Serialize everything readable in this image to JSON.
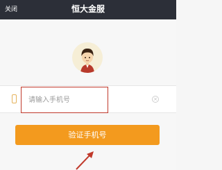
{
  "navbar": {
    "close_label": "关闭",
    "title": "恒大金服"
  },
  "login": {
    "phone_placeholder": "请输入手机号",
    "verify_button": "验证手机号"
  },
  "icons": {
    "avatar": "user-avatar",
    "phone": "phone-icon",
    "clear": "clear-icon"
  },
  "colors": {
    "navbar": "#2c2f38",
    "button": "#f39a1e",
    "highlight": "#c0392b"
  }
}
